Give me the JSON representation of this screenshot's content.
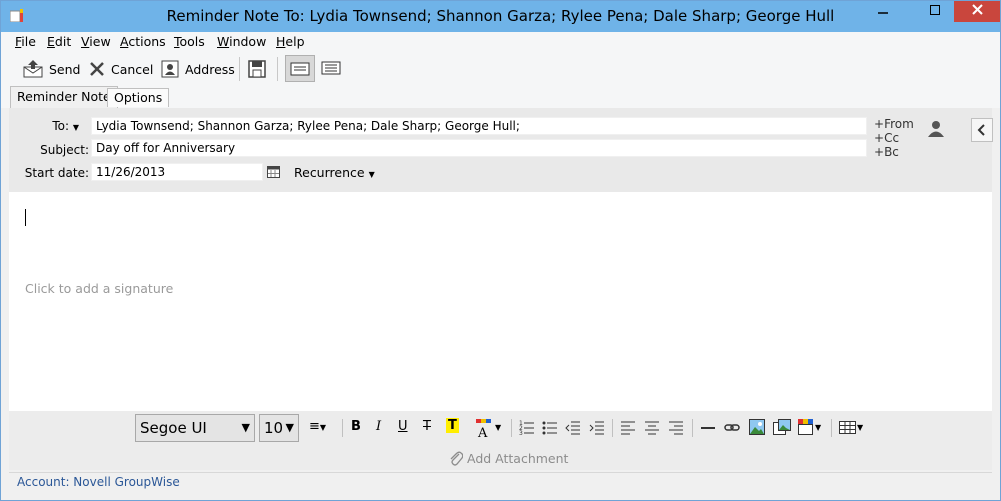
{
  "window": {
    "title": "Reminder Note To: Lydia Townsend; Shannon Garza; Rylee Pena; Dale Sharp; George Hull"
  },
  "menu": [
    "File",
    "Edit",
    "View",
    "Actions",
    "Tools",
    "Window",
    "Help"
  ],
  "menu_mnemonics": [
    "F",
    "E",
    "V",
    "A",
    "T",
    "W",
    "H"
  ],
  "toolbar": {
    "send_label": "Send",
    "cancel_label": "Cancel",
    "address_label": "Address"
  },
  "tabs": {
    "reminder_note": "Reminder Note",
    "options": "Options"
  },
  "header": {
    "to_label": "To:",
    "to_value": "Lydia Townsend;  Shannon Garza;  Rylee Pena;  Dale Sharp;  George Hull;",
    "subject_label": "Subject:",
    "subject_value": "Day off for Anniversary",
    "start_date_label": "Start date:",
    "start_date_value": "11/26/2013",
    "recurrence_label": "Recurrence",
    "from_link": "From",
    "cc_link": "Cc",
    "bc_link": "Bc"
  },
  "body": {
    "signature_placeholder": "Click to add a signature"
  },
  "format": {
    "font": "Segoe UI",
    "size": "10"
  },
  "attachment": {
    "label": "Add Attachment"
  },
  "status": {
    "account": "Account: Novell GroupWise"
  },
  "colors": {
    "titlebar": "#6fb3e8",
    "close_button": "#c9463d",
    "status_text": "#2b5797"
  }
}
